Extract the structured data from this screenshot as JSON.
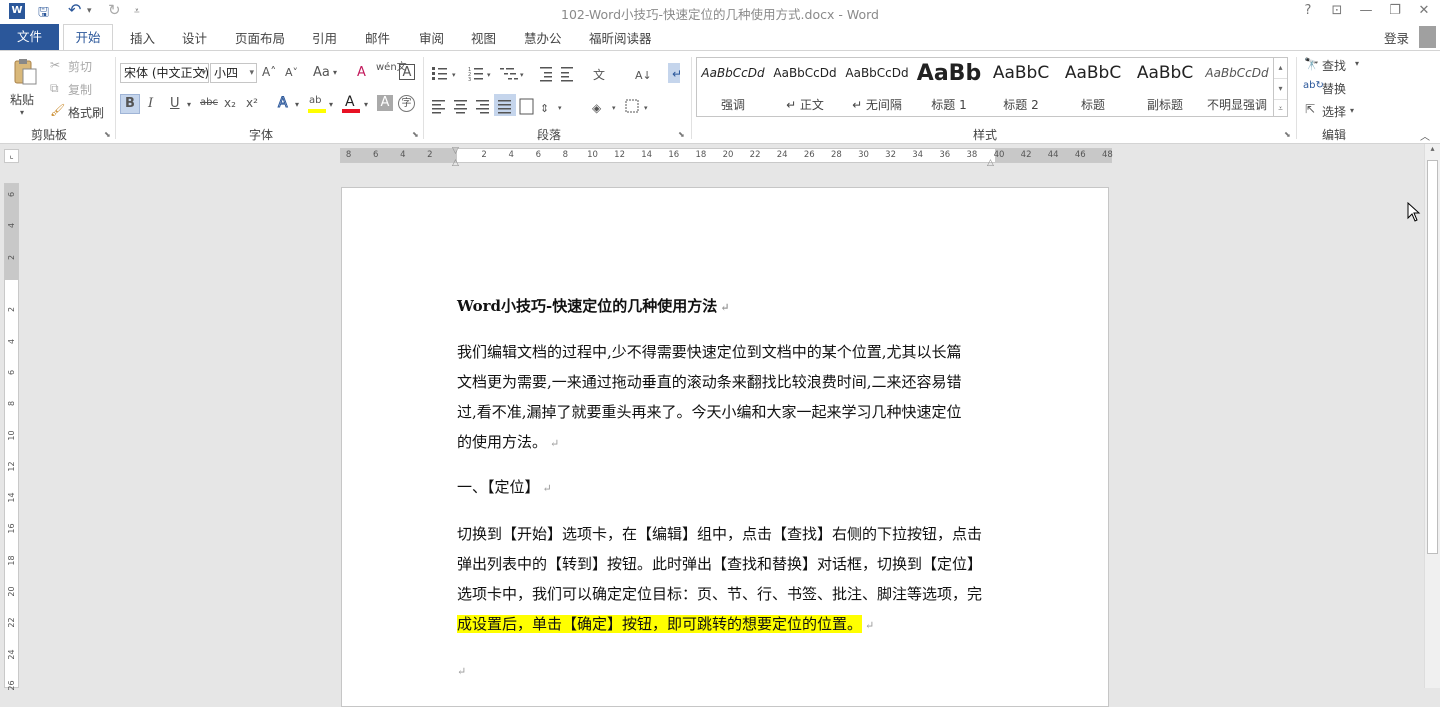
{
  "window": {
    "title": "102-Word小技巧-快速定位的几种使用方式.docx - Word",
    "help": "?",
    "ribbon_display": "⊡",
    "minimize": "—",
    "restore": "❐",
    "close": "✕"
  },
  "quick_access": {
    "app_icon": "W",
    "save": "🖫",
    "undo": "↶",
    "undo_dropdown": "▾",
    "redo": "↻",
    "customize": "⩡"
  },
  "tabs": {
    "file": "文件",
    "home": "开始",
    "insert": "插入",
    "design": "设计",
    "layout": "页面布局",
    "references": "引用",
    "mailings": "邮件",
    "review": "审阅",
    "view": "视图",
    "smart_office": "慧办公",
    "foxit": "福昕阅读器",
    "login": "登录"
  },
  "clipboard": {
    "paste": "粘贴",
    "cut": "剪切",
    "copy": "复制",
    "format_painter": "格式刷",
    "group_label": "剪贴板"
  },
  "font": {
    "font_name": "宋体 (中文正文)",
    "font_size": "小四",
    "grow": "A˄",
    "shrink": "A˅",
    "change_case": "Aa",
    "clear_format": "A",
    "phonetic": "wén文",
    "char_border": "A",
    "bold": "B",
    "italic": "I",
    "underline": "U",
    "strikethrough": "abc",
    "subscript": "x₂",
    "superscript": "x²",
    "text_effects": "A",
    "highlight": "ab",
    "font_color": "A",
    "char_shading": "A",
    "enclose": "字",
    "group_label": "字体"
  },
  "paragraph": {
    "group_label": "段落"
  },
  "styles": {
    "items": [
      {
        "preview": "AaBbCcDd",
        "name": "强调"
      },
      {
        "preview": "AaBbCcDd",
        "name": "↵ 正文"
      },
      {
        "preview": "AaBbCcDd",
        "name": "↵ 无间隔"
      },
      {
        "preview": "AaBb",
        "name": "标题 1"
      },
      {
        "preview": "AaBbC",
        "name": "标题 2"
      },
      {
        "preview": "AaBbC",
        "name": "标题"
      },
      {
        "preview": "AaBbC",
        "name": "副标题"
      },
      {
        "preview": "AaBbCcDd",
        "name": "不明显强调"
      }
    ],
    "group_label": "样式"
  },
  "editing": {
    "find": "查找",
    "replace": "替换",
    "select": "选择",
    "group_label": "编辑"
  },
  "ruler": {
    "h_left": [
      "8",
      "6",
      "4",
      "2"
    ],
    "h_right": [
      "2",
      "4",
      "6",
      "8",
      "10",
      "12",
      "14",
      "16",
      "18",
      "20",
      "22",
      "24",
      "26",
      "28",
      "30",
      "32",
      "34",
      "36",
      "38",
      "40",
      "42",
      "44",
      "46",
      "48"
    ],
    "v_top": [
      "6",
      "4",
      "2"
    ],
    "v_body": [
      "2",
      "4",
      "6",
      "8",
      "10",
      "12",
      "14",
      "16",
      "18",
      "20",
      "22",
      "24",
      "26"
    ]
  },
  "document": {
    "title": "Word小技巧-快速定位的几种使用方法",
    "para1_lines": [
      "我们编辑文档的过程中,少不得需要快速定位到文档中的某个位置,尤其以长篇",
      "文档更为需要,一来通过拖动垂直的滚动条来翻找比较浪费时间,二来还容易错",
      "过,看不准,漏掉了就要重头再来了。今天小编和大家一起来学习几种快速定位",
      "的使用方法。"
    ],
    "heading1": "一、【定位】",
    "para2_lines": [
      "切换到【开始】选项卡，在【编辑】组中，点击【查找】右侧的下拉按钮，点击",
      "弹出列表中的【转到】按钮。此时弹出【查找和替换】对话框，切换到【定位】",
      "选项卡中，我们可以确定定位目标：页、节、行、书签、批注、脚注等选项，完"
    ],
    "para2_highlight": "成设置后，单击【确定】按钮，即可跳转的想要定位的位置。",
    "paragraph_mark": "↵",
    "highlight_color": "#ffff00"
  },
  "colors": {
    "accent": "#2b579a",
    "font_color_bar": "#e81123",
    "highlight_bar": "#ffff00"
  }
}
